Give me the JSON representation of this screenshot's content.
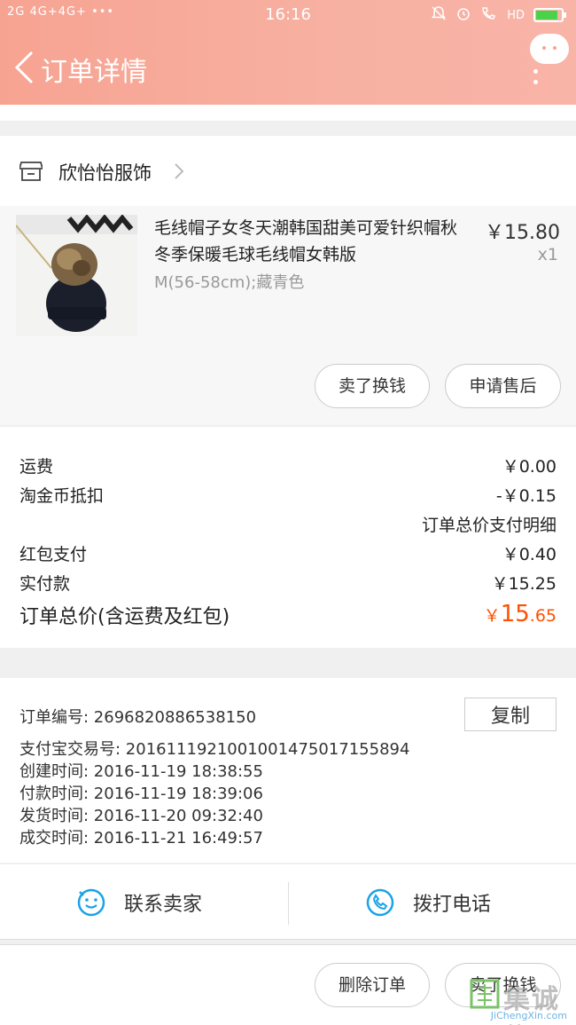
{
  "status_bar": {
    "left": "2G 4G+4G+ •••",
    "time": "16:16",
    "right": "HD"
  },
  "header": {
    "title": "订单详情"
  },
  "shop": {
    "name": "欣怡怡服饰"
  },
  "product": {
    "title": "毛线帽子女冬天潮韩国甜美可爱针织帽秋冬季保暖毛球毛线帽女韩版",
    "sku": "M(56-58cm);藏青色",
    "price": "￥15.80",
    "qty": "x1",
    "actions": [
      "卖了换钱",
      "申请售后"
    ]
  },
  "summary": {
    "shipping_label": "运费",
    "shipping_value": "￥0.00",
    "coin_label": "淘金币抵扣",
    "coin_value": "-￥0.15",
    "detail_link": "订单总价支付明细",
    "redpacket_label": "红包支付",
    "redpacket_value": "￥0.40",
    "paid_label": "实付款",
    "paid_value": "￥15.25",
    "total_label": "订单总价(含运费及红包)",
    "total_currency": "￥",
    "total_int": "15",
    "total_dec": ".65"
  },
  "order_info": {
    "order_no": "订单编号:   2696820886538150",
    "copy_label": "复制",
    "alipay_no": "支付宝交易号:   2016111921001001475017155894",
    "created": "创建时间:   2016-11-19  18:38:55",
    "paid": "付款时间:   2016-11-19  18:39:06",
    "shipped": "发货时间:   2016-11-20  09:32:40",
    "completed": "成交时间:   2016-11-21  16:49:57"
  },
  "contact": {
    "seller_label": "联系卖家",
    "phone_label": "拨打电话"
  },
  "bottom": {
    "delete_label": "删除订单",
    "sell_label": "卖了换钱"
  },
  "watermark": {
    "main": "集诚信",
    "sub": "JiChengXin.com"
  },
  "colors": {
    "header": "#f7a392",
    "accent": "#ff5000",
    "icon_blue": "#1aa3e8"
  }
}
